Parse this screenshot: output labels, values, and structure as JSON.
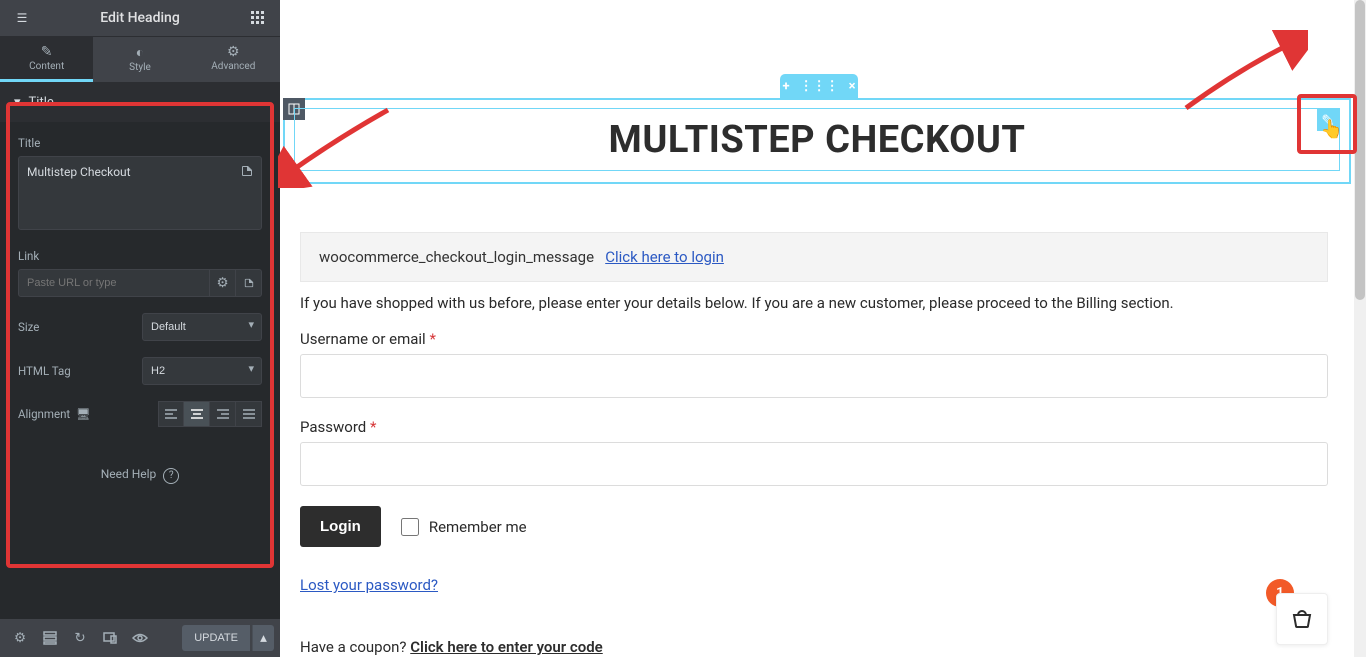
{
  "panel": {
    "title": "Edit Heading",
    "tabs": {
      "content": "Content",
      "style": "Style",
      "advanced": "Advanced"
    },
    "section": "Title",
    "labels": {
      "title": "Title",
      "link": "Link",
      "size": "Size",
      "html_tag": "HTML Tag",
      "alignment": "Alignment"
    },
    "values": {
      "title": "Multistep Checkout",
      "link_placeholder": "Paste URL or type",
      "size": "Default",
      "html_tag": "H2"
    },
    "help": "Need Help",
    "footer": {
      "update": "UPDATE"
    }
  },
  "canvas": {
    "heading": "MULTISTEP CHECKOUT",
    "login_banner_hook": "woocommerce_checkout_login_message",
    "login_banner_link": "Click here to login",
    "instructions": "If you have shopped with us before, please enter your details below. If you are a new customer, please proceed to the Billing section.",
    "username_label": "Username or email",
    "password_label": "Password",
    "login_btn": "Login",
    "remember": "Remember me",
    "lost_password": "Lost your password?",
    "coupon_q": "Have a coupon?",
    "coupon_link": "Click here to enter your code",
    "cart_count": "1"
  }
}
